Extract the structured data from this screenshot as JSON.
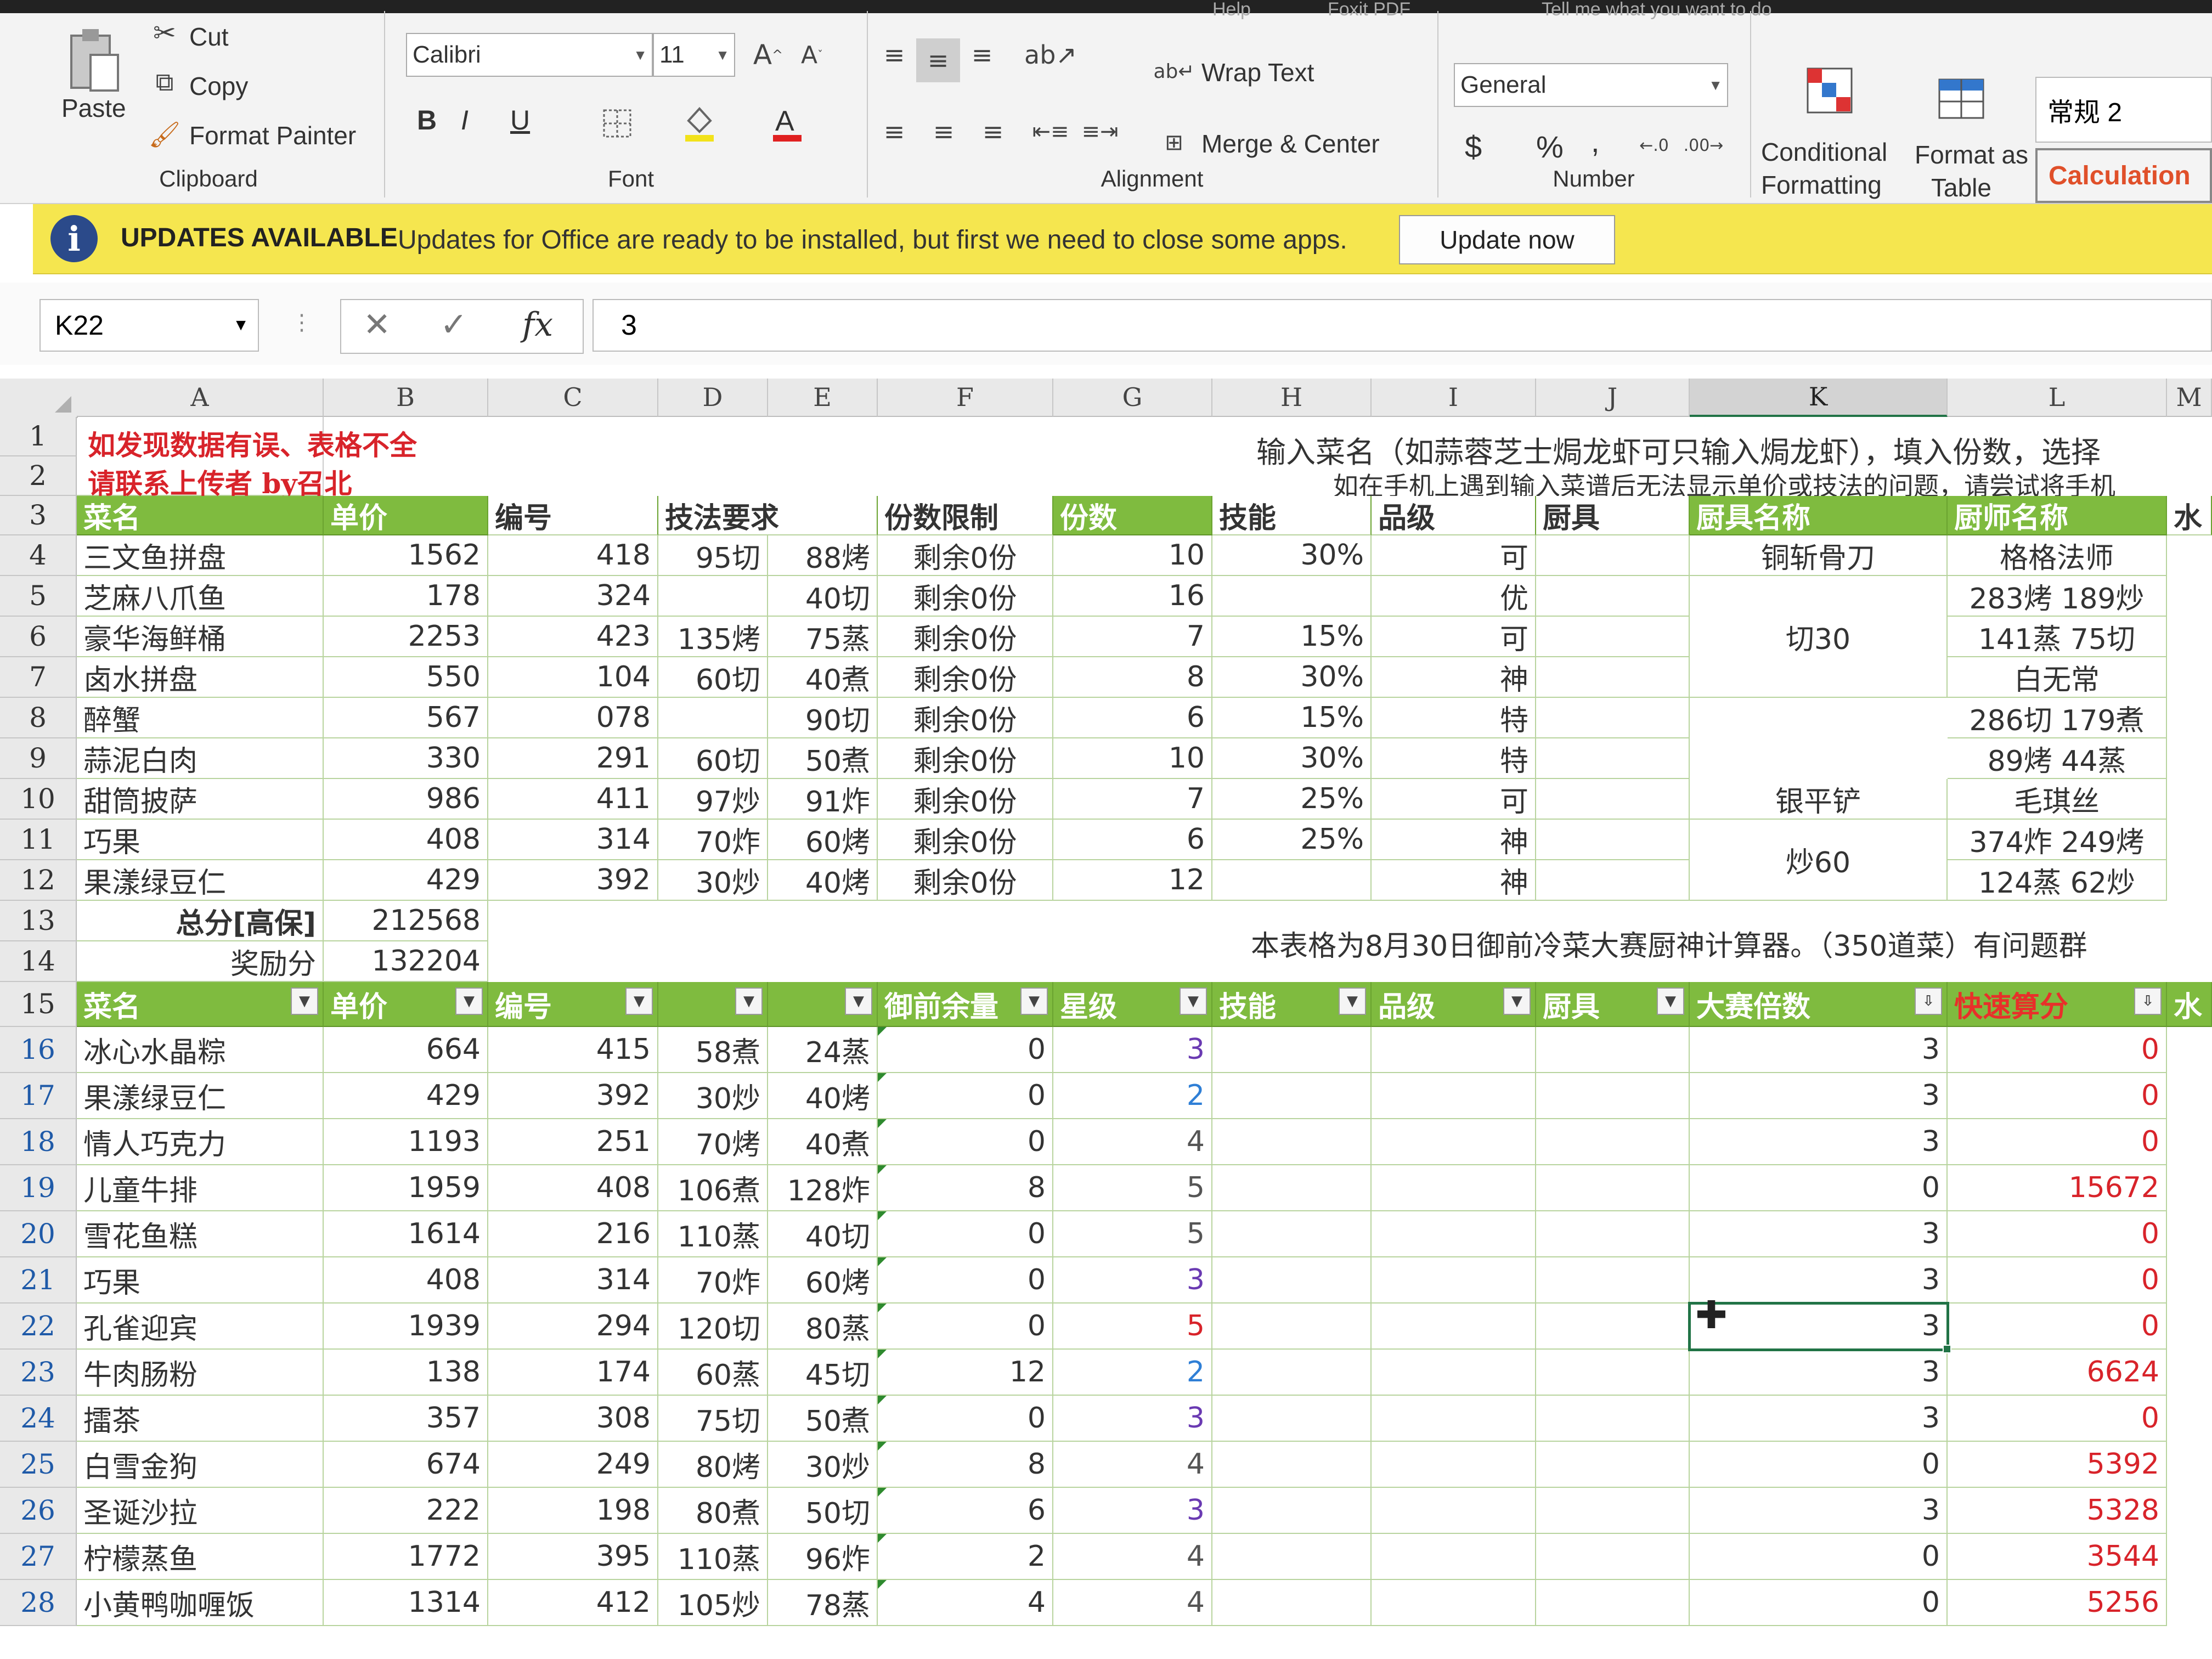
{
  "topstrip": [
    "Help",
    "Foxit PDF",
    "Tell me what you want to do"
  ],
  "ribbon": {
    "clipboard": {
      "paste": "Paste",
      "cut": "Cut",
      "copy": "Copy",
      "format_painter": "Format Painter",
      "group": "Clipboard"
    },
    "font": {
      "name": "Calibri",
      "size": "11",
      "bold": "B",
      "italic": "I",
      "underline": "U",
      "group": "Font"
    },
    "alignment": {
      "wrap_text": "Wrap Text",
      "merge_center": "Merge & Center",
      "group": "Alignment"
    },
    "number": {
      "format": "General",
      "currency": "$",
      "percent": "%",
      "comma": ",",
      "group": "Number"
    },
    "styles": {
      "conditional": "Conditional",
      "formatting": "Formatting",
      "format_as": "Format as",
      "table": "Table",
      "normal": "常规 2",
      "calculation": "Calculation"
    }
  },
  "update_bar": {
    "title": "UPDATES AVAILABLE",
    "message": "Updates for Office are ready to be installed, but first we need to close some apps.",
    "button": "Update now"
  },
  "formula_bar": {
    "name_box": "K22",
    "cancel": "✕",
    "enter": "✓",
    "fx": "fx",
    "value": "3"
  },
  "columns": [
    "A",
    "B",
    "C",
    "D",
    "E",
    "F",
    "G",
    "H",
    "I",
    "J",
    "K",
    "L",
    "M"
  ],
  "rows": [
    "1",
    "2",
    "3",
    "4",
    "5",
    "6",
    "7",
    "8",
    "9",
    "10",
    "11",
    "12",
    "13",
    "14",
    "15",
    "16",
    "17",
    "18",
    "19",
    "20",
    "21",
    "22",
    "23",
    "24",
    "25",
    "26",
    "27",
    "28"
  ],
  "notes": {
    "warn1": "如发现数据有误、表格不全",
    "warn2": "请联系上传者 by召北",
    "instruction1": "输入菜名（如蒜蓉芝士焗龙虾可只输入焗龙虾），填入份数，选择",
    "instruction2": "如在手机上遇到输入菜谱后无法显示单价或技法的问题，请尝试将手机",
    "footer": "本表格为8月30日御前冷菜大赛厨神计算器。（350道菜）有问题群"
  },
  "header_top": {
    "name": "菜名",
    "price": "单价",
    "id": "编号",
    "tech": "技法要求",
    "limit": "份数限制",
    "portions": "份数",
    "skill": "技能",
    "grade": "品级",
    "tool": "厨具",
    "tool_name": "厨具名称",
    "chef_name": "厨师名称",
    "m": "水"
  },
  "top_rows": [
    {
      "name": "三文鱼拼盘",
      "price": "1562",
      "id": "418",
      "d": "95切",
      "e": "88烤",
      "f": "剩余0份",
      "g": "10",
      "h": "30%",
      "i": "可"
    },
    {
      "name": "芝麻八爪鱼",
      "price": "178",
      "id": "324",
      "d": "",
      "e": "40切",
      "f": "剩余0份",
      "g": "16",
      "h": "",
      "i": "优"
    },
    {
      "name": "豪华海鲜桶",
      "price": "2253",
      "id": "423",
      "d": "135烤",
      "e": "75蒸",
      "f": "剩余0份",
      "g": "7",
      "h": "15%",
      "i": "可"
    },
    {
      "name": "卤水拼盘",
      "price": "550",
      "id": "104",
      "d": "60切",
      "e": "40煮",
      "f": "剩余0份",
      "g": "8",
      "h": "30%",
      "i": "神"
    },
    {
      "name": "醉蟹",
      "price": "567",
      "id": "078",
      "d": "",
      "e": "90切",
      "f": "剩余0份",
      "g": "6",
      "h": "15%",
      "i": "特"
    },
    {
      "name": "蒜泥白肉",
      "price": "330",
      "id": "291",
      "d": "60切",
      "e": "50煮",
      "f": "剩余0份",
      "g": "10",
      "h": "30%",
      "i": "特"
    },
    {
      "name": "甜筒披萨",
      "price": "986",
      "id": "411",
      "d": "97炒",
      "e": "91炸",
      "f": "剩余0份",
      "g": "7",
      "h": "25%",
      "i": "可"
    },
    {
      "name": "巧果",
      "price": "408",
      "id": "314",
      "d": "70炸",
      "e": "60烤",
      "f": "剩余0份",
      "g": "6",
      "h": "25%",
      "i": "神"
    },
    {
      "name": "果漾绿豆仁",
      "price": "429",
      "id": "392",
      "d": "30炒",
      "e": "40烤",
      "f": "剩余0份",
      "g": "12",
      "h": "",
      "i": "神"
    }
  ],
  "tools": {
    "k5": "铜斩骨刀",
    "k6": "切30",
    "k11": "银平铲",
    "k12": "炒60"
  },
  "chefs": {
    "l5": "格格法师",
    "l6": "283烤 189炒",
    "l7": "141蒸 75切",
    "l8": "白无常",
    "l9": "286切 179煮",
    "l10": "89烤 44蒸",
    "l11": "毛琪丝",
    "l12": "374炸 249烤",
    "l13": "124蒸 62炒"
  },
  "totals": {
    "total_label": "总分[高保]",
    "total_value": "212568",
    "bonus_label": "奖励分",
    "bonus_value": "132204"
  },
  "header_bottom": {
    "name": "菜名",
    "price": "单价",
    "id": "编号",
    "remain": "御前余量",
    "star": "星级",
    "skill": "技能",
    "grade": "品级",
    "tool": "厨具",
    "multiplier": "大赛倍数",
    "score": "快速算分",
    "m": "水"
  },
  "bottom_rows": [
    {
      "name": "冰心水晶粽",
      "price": "664",
      "id": "415",
      "d": "58煮",
      "e": "24蒸",
      "f": "0",
      "star": "3",
      "star_color": "purple",
      "k": "3",
      "l": "0"
    },
    {
      "name": "果漾绿豆仁",
      "price": "429",
      "id": "392",
      "d": "30炒",
      "e": "40烤",
      "f": "0",
      "star": "2",
      "star_color": "blue",
      "k": "3",
      "l": "0"
    },
    {
      "name": "情人巧克力",
      "price": "1193",
      "id": "251",
      "d": "70烤",
      "e": "40煮",
      "f": "0",
      "star": "4",
      "star_color": "gray",
      "k": "3",
      "l": "0"
    },
    {
      "name": "儿童牛排",
      "price": "1959",
      "id": "408",
      "d": "106煮",
      "e": "128炸",
      "f": "8",
      "star": "5",
      "star_color": "gray",
      "k": "0",
      "l": "15672"
    },
    {
      "name": "雪花鱼糕",
      "price": "1614",
      "id": "216",
      "d": "110蒸",
      "e": "40切",
      "f": "0",
      "star": "5",
      "star_color": "gray",
      "k": "3",
      "l": "0"
    },
    {
      "name": "巧果",
      "price": "408",
      "id": "314",
      "d": "70炸",
      "e": "60烤",
      "f": "0",
      "star": "3",
      "star_color": "purple",
      "k": "3",
      "l": "0"
    },
    {
      "name": "孔雀迎宾",
      "price": "1939",
      "id": "294",
      "d": "120切",
      "e": "80蒸",
      "f": "0",
      "star": "5",
      "star_color": "red",
      "k": "3",
      "l": "0"
    },
    {
      "name": "牛肉肠粉",
      "price": "138",
      "id": "174",
      "d": "60蒸",
      "e": "45切",
      "f": "12",
      "star": "2",
      "star_color": "blue",
      "k": "3",
      "l": "6624"
    },
    {
      "name": "擂茶",
      "price": "357",
      "id": "308",
      "d": "75切",
      "e": "50煮",
      "f": "0",
      "star": "3",
      "star_color": "purple",
      "k": "3",
      "l": "0"
    },
    {
      "name": "白雪金狗",
      "price": "674",
      "id": "249",
      "d": "80烤",
      "e": "30炒",
      "f": "8",
      "star": "4",
      "star_color": "gray",
      "k": "0",
      "l": "5392"
    },
    {
      "name": "圣诞沙拉",
      "price": "222",
      "id": "198",
      "d": "80煮",
      "e": "50切",
      "f": "6",
      "star": "3",
      "star_color": "purple",
      "k": "3",
      "l": "5328"
    },
    {
      "name": "柠檬蒸鱼",
      "price": "1772",
      "id": "395",
      "d": "110蒸",
      "e": "96炸",
      "f": "2",
      "star": "4",
      "star_color": "gray",
      "k": "0",
      "l": "3544"
    },
    {
      "name": "小黄鸭咖喱饭",
      "price": "1314",
      "id": "412",
      "d": "105炒",
      "e": "78蒸",
      "f": "4",
      "star": "4",
      "star_color": "gray",
      "k": "0",
      "l": "5256"
    }
  ],
  "colors": {
    "header_green": "#7fbb3f",
    "update_yellow": "#f5e64f",
    "selection": "#217346",
    "score_red": "#d8232a"
  }
}
